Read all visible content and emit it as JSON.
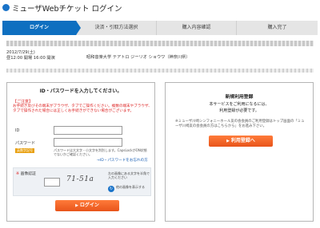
{
  "header": {
    "title": "ミューザWebチケット ログイン"
  },
  "steps": [
    {
      "label": "ログイン",
      "active": true
    },
    {
      "label": "決済・引取方法選択",
      "active": false
    },
    {
      "label": "購入内容確認",
      "active": false
    },
    {
      "label": "購入完了",
      "active": false
    }
  ],
  "event": {
    "date_line1": "2012/7/29(土)",
    "date_line2": "昼12:00 開場 16:00 開演",
    "venue": "昭和音楽大学 テアトロ ジーリオ ショウワ（神奈川県）"
  },
  "login": {
    "title": "ID・パスワードを入力してください。",
    "notice_heading": "【ご注意】",
    "notice_text": "お手続き及びその端末がブラウザ、タブでご操作ください。複数の端末やブラウザ、タブで操作された場合には正しくお手続きができない場合がございます。",
    "id_label": "ID",
    "id_value": "",
    "password_label": "パスワード",
    "password_value": "",
    "password_badge": "英数字記号",
    "password_hint": "パスワードは大文字・小文字を判別します。CapsLockがON状態でないかご確認ください。",
    "forgot_link": "→ID・パスワードをお忘れの方",
    "captcha_label": "画像認証",
    "captcha_mark": "※",
    "captcha_value": "",
    "captcha_text": "71-51a",
    "captcha_help": "左の画像にある文字を半角で入力ください",
    "refresh_text": "他の画像を表示する",
    "login_button": "ログイン"
  },
  "register": {
    "title": "新規利用登録",
    "desc_line1": "本サービスをご利用になるには、",
    "desc_line2": "利用登録が必要です。",
    "note": "※ミューザ川崎シンフォニーホール友の会会員のご利用登録はトップ画面の「ミューザ川崎友の会会員の方はこちらから」をお進み下さい。",
    "register_button": "利用登録へ"
  },
  "colors": {
    "primary": "#0e6fc0",
    "button": "#ee5f22",
    "notice": "#dd2222"
  }
}
